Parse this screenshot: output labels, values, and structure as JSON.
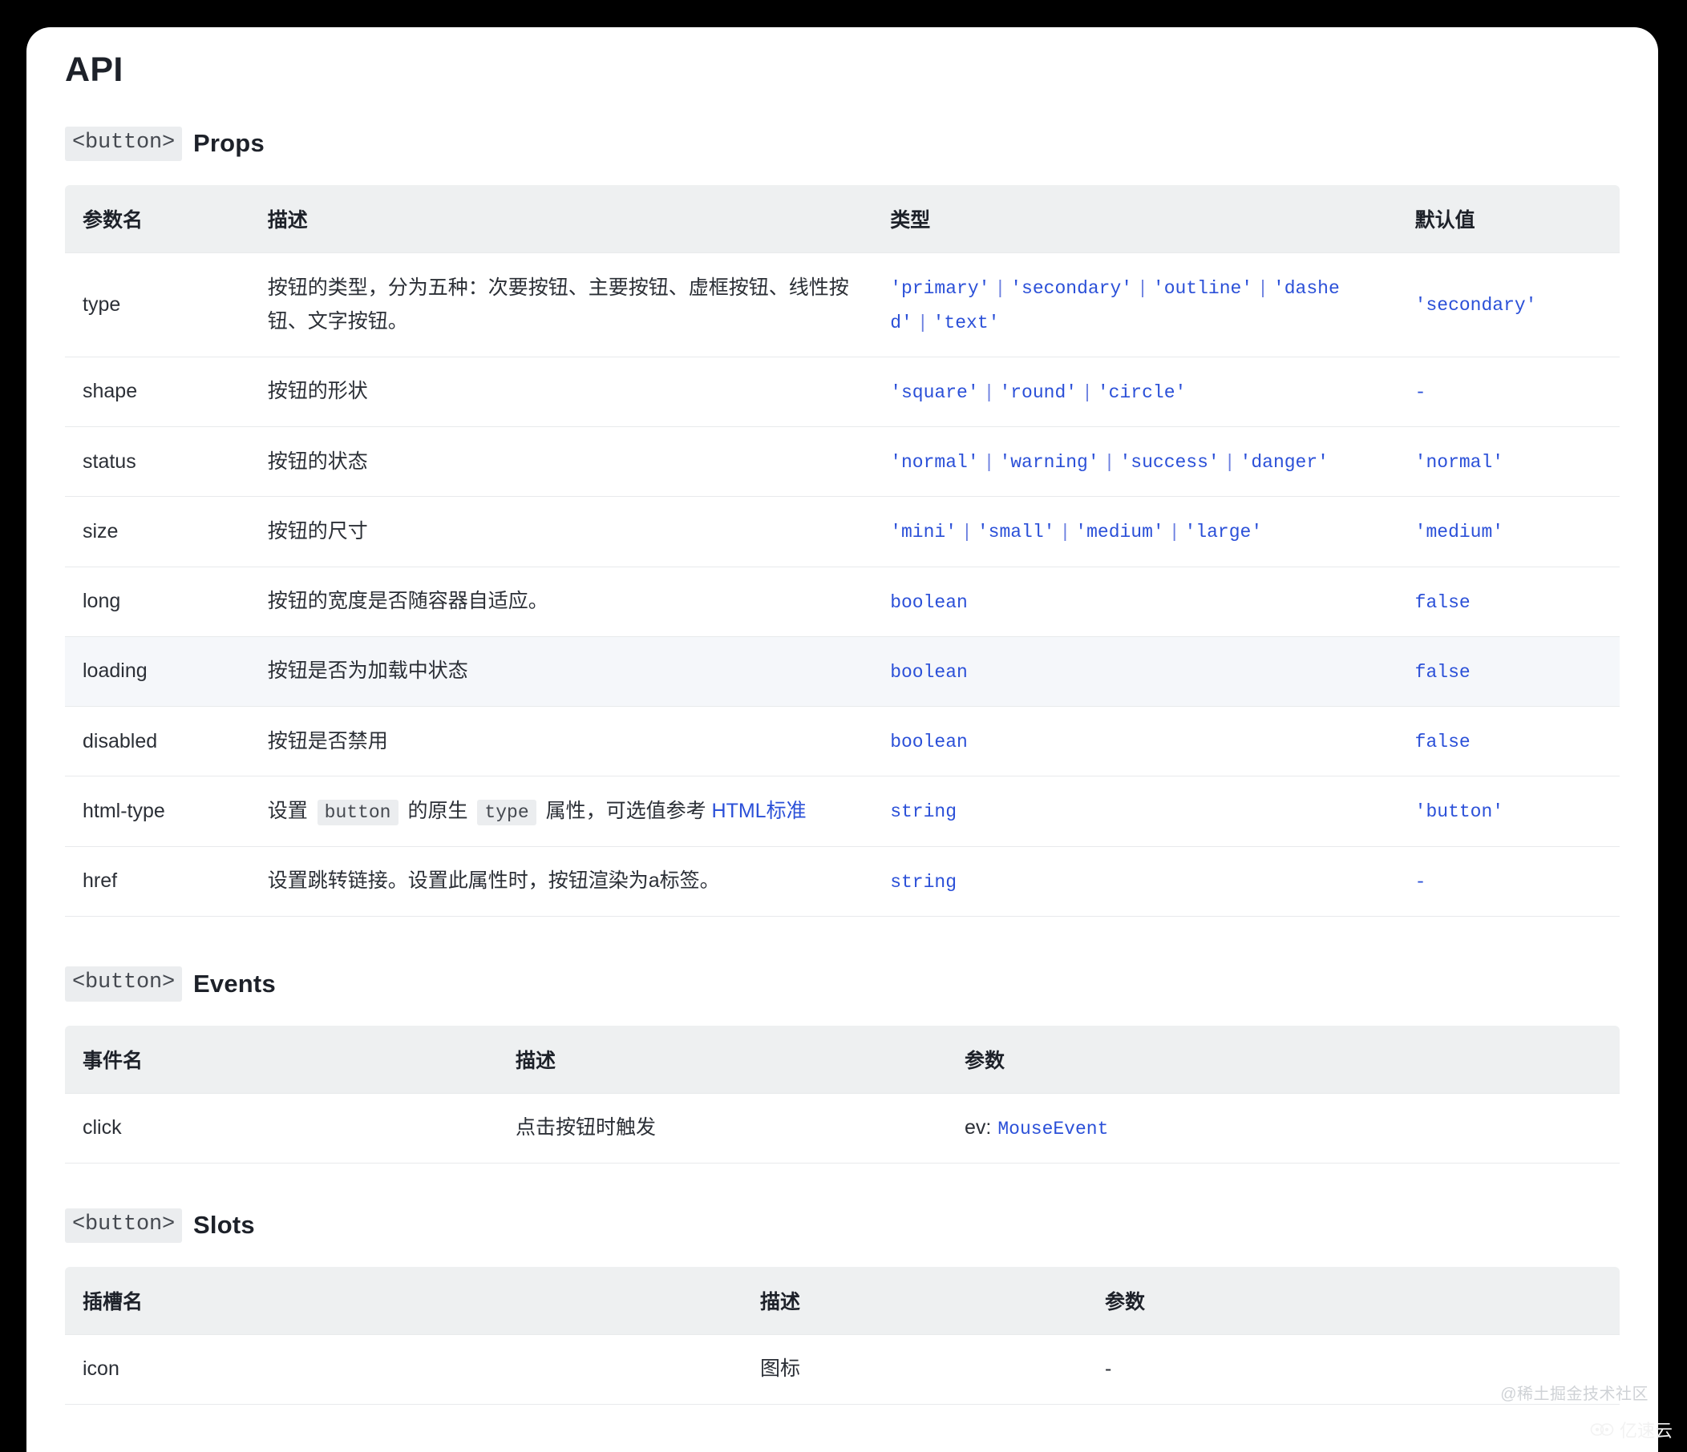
{
  "page": {
    "title": "API"
  },
  "props_section": {
    "tag": "<button>",
    "label": "Props",
    "headers": [
      "参数名",
      "描述",
      "类型",
      "默认值"
    ],
    "rows": [
      {
        "name": "type",
        "desc": "按钮的类型，分为五种：次要按钮、主要按钮、虚框按钮、线性按钮、文字按钮。",
        "type_parts": [
          "'primary'",
          "'secondary'",
          "'outline'",
          "'dashed'",
          "'text'"
        ],
        "default": "'secondary'",
        "highlight": false
      },
      {
        "name": "shape",
        "desc": "按钮的形状",
        "type_parts": [
          "'square'",
          "'round'",
          "'circle'"
        ],
        "default": "-",
        "highlight": false
      },
      {
        "name": "status",
        "desc": "按钮的状态",
        "type_parts": [
          "'normal'",
          "'warning'",
          "'success'",
          "'danger'"
        ],
        "default": "'normal'",
        "highlight": false
      },
      {
        "name": "size",
        "desc": "按钮的尺寸",
        "type_parts": [
          "'mini'",
          "'small'",
          "'medium'",
          "'large'"
        ],
        "default": "'medium'",
        "highlight": false
      },
      {
        "name": "long",
        "desc": "按钮的宽度是否随容器自适应。",
        "type_parts": [
          "boolean"
        ],
        "default": "false",
        "highlight": false
      },
      {
        "name": "loading",
        "desc": "按钮是否为加载中状态",
        "type_parts": [
          "boolean"
        ],
        "default": "false",
        "highlight": true
      },
      {
        "name": "disabled",
        "desc": "按钮是否禁用",
        "type_parts": [
          "boolean"
        ],
        "default": "false",
        "highlight": false
      },
      {
        "name": "html-type",
        "desc_rich": {
          "segments": [
            {
              "kind": "text",
              "value": "设置 "
            },
            {
              "kind": "code",
              "value": "button"
            },
            {
              "kind": "text",
              "value": " 的原生 "
            },
            {
              "kind": "code",
              "value": "type"
            },
            {
              "kind": "text",
              "value": " 属性，可选值参考 "
            },
            {
              "kind": "link",
              "value": "HTML标准"
            }
          ]
        },
        "type_parts": [
          "string"
        ],
        "default": "'button'",
        "highlight": false
      },
      {
        "name": "href",
        "desc": "设置跳转链接。设置此属性时，按钮渲染为a标签。",
        "type_parts": [
          "string"
        ],
        "default": "-",
        "highlight": false
      }
    ]
  },
  "events_section": {
    "tag": "<button>",
    "label": "Events",
    "headers": [
      "事件名",
      "描述",
      "参数"
    ],
    "rows": [
      {
        "name": "click",
        "desc": "点击按钮时触发",
        "arg_label": "ev:",
        "arg_type": "MouseEvent"
      }
    ]
  },
  "slots_section": {
    "tag": "<button>",
    "label": "Slots",
    "headers": [
      "插槽名",
      "描述",
      "参数"
    ],
    "rows": [
      {
        "name": "icon",
        "desc": "图标",
        "arg": "-"
      }
    ]
  },
  "watermarks": {
    "juejin": "@稀土掘金技术社区",
    "yisu": "亿速云"
  },
  "colors": {
    "accent_code": "#2b50d8",
    "header_bg": "#eef0f1",
    "row_highlight": "#f5f7fa",
    "border": "#e8eaec",
    "text": "#1d2129",
    "page_bg": "#000000",
    "card_bg": "#ffffff"
  }
}
